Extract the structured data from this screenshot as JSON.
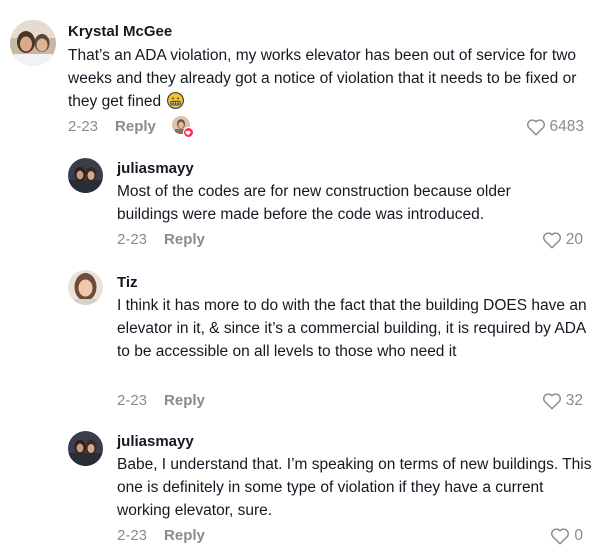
{
  "comments": [
    {
      "username": "Krystal McGee",
      "text": "That’s an ADA violation, my works elevator has been out of service for two weeks and they already got a notice of violation that it needs to be fixed or they get fined",
      "emoji": "grimacing-face",
      "date": "2-23",
      "reply_label": "Reply",
      "likes": "6483",
      "liked_by_creator": true
    },
    {
      "username": "juliasmayy",
      "text": "Most of the codes are for new construction because older buildings were made before the code was introduced.",
      "date": "2-23",
      "reply_label": "Reply",
      "likes": "20"
    },
    {
      "username": "Tiz",
      "text": "I think it has more to do with the fact that the building DOES have an elevator in it, & since it’s a commercial building, it is required by ADA to be accessible on all levels to those who need it",
      "date": "2-23",
      "reply_label": "Reply",
      "likes": "32"
    },
    {
      "username": "juliasmayy",
      "text": "Babe, I understand that. I’m speaking on terms of new buildings. This one is definitely in some type of violation if they have a current working elevator, sure.",
      "date": "2-23",
      "reply_label": "Reply",
      "likes": "0"
    }
  ],
  "icons": {
    "like": "heart-outline-icon",
    "creator_like_badge": "heart-badge-icon"
  },
  "colors": {
    "text": "#161823",
    "muted": "#8a8b91",
    "accent": "#fe2c55"
  }
}
